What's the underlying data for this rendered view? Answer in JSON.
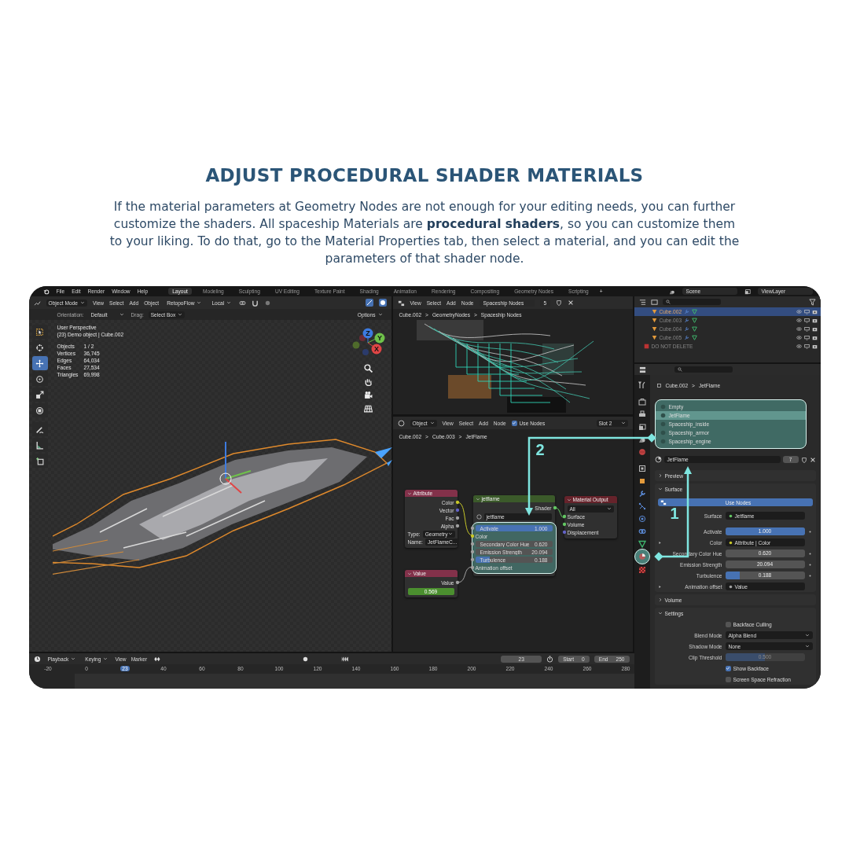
{
  "heading": "ADJUST PROCEDURAL SHADER MATERIALS",
  "description": "If the material parameters at Geometry Nodes are not enough for your editing needs, you can further customize the shaders. All spaceship Materials are **procedural shaders**, so you can customize them to your liking. To do that, go to the Material Properties tab, then select a material, and you can edit the parameters of that shader node.",
  "top_bar": {
    "menus": [
      "File",
      "Edit",
      "Render",
      "Window",
      "Help"
    ],
    "workspaces": [
      {
        "label": "Layout",
        "selected": true
      },
      {
        "label": "Modeling",
        "selected": false
      },
      {
        "label": "Sculpting",
        "selected": false
      },
      {
        "label": "UV Editing",
        "selected": false
      },
      {
        "label": "Texture Paint",
        "selected": false
      },
      {
        "label": "Shading",
        "selected": false
      },
      {
        "label": "Animation",
        "selected": false
      },
      {
        "label": "Rendering",
        "selected": false
      },
      {
        "label": "Compositing",
        "selected": false
      },
      {
        "label": "Geometry Nodes",
        "selected": false
      },
      {
        "label": "Scripting",
        "selected": false
      }
    ],
    "add_workspace": "+",
    "scene": "Scene",
    "view_layer": "ViewLayer"
  },
  "viewport": {
    "mode": "Object Mode",
    "menus": [
      "View",
      "Select",
      "Add",
      "Object"
    ],
    "addon": "RetopoFlow",
    "pivot": "Local",
    "orientation_label": "Orientation:",
    "orientation": "Default",
    "drag_label": "Drag:",
    "drag": "Select Box",
    "options": "Options",
    "tools": [
      {
        "kind": "select",
        "selected": false
      },
      {
        "kind": "cursor",
        "selected": false
      },
      {
        "kind": "move",
        "selected": true
      },
      {
        "kind": "rotate",
        "selected": false
      },
      {
        "kind": "scale",
        "selected": false
      },
      {
        "kind": "transform",
        "selected": false
      },
      {
        "kind": "annotate",
        "selected": false
      },
      {
        "kind": "measure",
        "selected": false
      },
      {
        "kind": "add_cube",
        "selected": false
      }
    ],
    "view_name": "User Perspective",
    "object_line": "(23) Demo object | Cube.002",
    "stats": [
      {
        "label": "Objects",
        "value": "1 / 2"
      },
      {
        "label": "Vertices",
        "value": "36,745"
      },
      {
        "label": "Edges",
        "value": "64,034"
      },
      {
        "label": "Faces",
        "value": "27,534"
      },
      {
        "label": "Triangles",
        "value": "69,998"
      }
    ],
    "gizmo_axes": [
      "Z",
      "Y",
      "X"
    ]
  },
  "geometry_editor": {
    "menus": [
      "View",
      "Select",
      "Add",
      "Node"
    ],
    "node_group": "Spaceship Nodes",
    "users": "5",
    "breadcrumb": [
      "Cube.002",
      ">",
      "GeometryNodes",
      ">",
      "Spaceship Nodes"
    ]
  },
  "shader_editor": {
    "object": "Object",
    "menus": [
      "View",
      "Select",
      "Add",
      "Node"
    ],
    "use_nodes": {
      "label": "Use Nodes",
      "checked": true
    },
    "slot": "Slot 2",
    "breadcrumb": [
      "Cube.002",
      ">",
      "Cube.003",
      ">",
      "JetFlame"
    ],
    "attribute_node": {
      "title": "Attribute",
      "outputs": [
        {
          "label": "Color",
          "color": "#c7c729"
        },
        {
          "label": "Vector",
          "color": "#6363c7"
        },
        {
          "label": "Fac",
          "color": "#a1a1a1"
        },
        {
          "label": "Alpha",
          "color": "#a1a1a1"
        }
      ],
      "type_label": "Type:",
      "type": "Geometry",
      "name_label": "Name:",
      "name": "JetFlameC..."
    },
    "value_node": {
      "title": "Value",
      "output": "Value",
      "value": "0.569"
    },
    "group_node": {
      "title": "jetflame",
      "output": "Shader",
      "datablock": "jetflame",
      "inputs": [
        {
          "kind": "slider",
          "label": "Activate",
          "value": "1.000",
          "level": 1
        },
        {
          "kind": "socket",
          "label": "Color",
          "color": "#c7c729"
        },
        {
          "kind": "number",
          "label": "Secondary Color Hue",
          "value": "0.620"
        },
        {
          "kind": "number",
          "label": "Emission Strength",
          "value": "20.094"
        },
        {
          "kind": "slider",
          "label": "Turbulence",
          "value": "0.188",
          "level": 0.188
        },
        {
          "kind": "socket",
          "label": "Animation offset",
          "color": "#a1a1a1"
        }
      ]
    },
    "output_node": {
      "title": "Material Output",
      "target": "All",
      "inputs": [
        {
          "label": "Surface",
          "color": "#63c763"
        },
        {
          "label": "Volume",
          "color": "#63c763"
        },
        {
          "label": "Displacement",
          "color": "#6363c7"
        }
      ]
    }
  },
  "outliner": {
    "rows": [
      {
        "name": "Cube.002",
        "kind": "object",
        "selected": true
      },
      {
        "name": "Cube.003",
        "kind": "object",
        "selected": false
      },
      {
        "name": "Cube.004",
        "kind": "object",
        "selected": false
      },
      {
        "name": "Cube.005",
        "kind": "object",
        "selected": false
      },
      {
        "name": "DO NOT DELETE",
        "kind": "collection",
        "selected": false
      }
    ]
  },
  "properties": {
    "tabs": [
      {
        "kind": "tool",
        "selected": false
      },
      {
        "kind": "render",
        "selected": false
      },
      {
        "kind": "output",
        "selected": false
      },
      {
        "kind": "view_layer",
        "selected": false
      },
      {
        "kind": "scene",
        "selected": false
      },
      {
        "kind": "world",
        "selected": false
      },
      {
        "kind": "collection",
        "selected": false
      },
      {
        "kind": "object",
        "selected": false
      },
      {
        "kind": "modifier",
        "selected": false
      },
      {
        "kind": "particles",
        "selected": false
      },
      {
        "kind": "physics",
        "selected": false
      },
      {
        "kind": "constraints",
        "selected": false
      },
      {
        "kind": "data",
        "selected": false
      },
      {
        "kind": "material",
        "selected": true
      },
      {
        "kind": "texture",
        "selected": false
      }
    ],
    "breadcrumb": [
      "Cube.002",
      ">",
      "JetFlame"
    ],
    "slots": [
      {
        "name": "Empty",
        "selected": false
      },
      {
        "name": "JetFlame",
        "selected": true
      },
      {
        "name": "Spaceship_inside",
        "selected": false
      },
      {
        "name": "Spaceship_armor",
        "selected": false
      },
      {
        "name": "Spaceship_engine",
        "selected": false
      }
    ],
    "material": "JetFlame",
    "users": "7",
    "panels": [
      {
        "title": "Preview",
        "expanded": false
      },
      {
        "title": "Surface",
        "expanded": true,
        "rows": [
          {
            "kind": "button",
            "label": "Use Nodes"
          },
          {
            "kind": "link",
            "label": "Surface",
            "value": "Jetflame",
            "color": "#63c763",
            "expandable": false
          },
          {
            "kind": "slider",
            "label": "Activate",
            "value": "1.000",
            "level": 1,
            "disabled": false
          },
          {
            "kind": "link",
            "label": "Color",
            "value": "Attribute | Color",
            "color": "#c7c729",
            "expandable": true
          },
          {
            "kind": "number",
            "label": "Secondary Color Hue",
            "value": "0.620"
          },
          {
            "kind": "number",
            "label": "Emission Strength",
            "value": "20.094"
          },
          {
            "kind": "slider",
            "label": "Turbulence",
            "value": "0.188",
            "level": 0.188,
            "disabled": false
          },
          {
            "kind": "link",
            "label": "Animation offset",
            "value": "Value",
            "color": "#a1a1a1",
            "expandable": true
          }
        ]
      },
      {
        "title": "Volume",
        "expanded": false
      },
      {
        "title": "Settings",
        "expanded": true,
        "rows": [
          {
            "kind": "checkbox",
            "label": "Backface Culling",
            "checked": false
          },
          {
            "kind": "dropdown",
            "label": "Blend Mode",
            "value": "Alpha Blend"
          },
          {
            "kind": "dropdown",
            "label": "Shadow Mode",
            "value": "None"
          },
          {
            "kind": "slider",
            "label": "Clip Threshold",
            "value": "0.500",
            "level": 0.5,
            "disabled": true
          },
          {
            "kind": "checkbox",
            "label": "Show Backface",
            "checked": true
          },
          {
            "kind": "checkbox",
            "label": "Screen Space Refraction",
            "checked": false
          }
        ]
      }
    ]
  },
  "timeline": {
    "dropdowns": [
      "Playback",
      "Keying"
    ],
    "menus": [
      "View",
      "Marker"
    ],
    "frame": "23",
    "start_label": "Start",
    "start": "0",
    "end_label": "End",
    "end": "250",
    "ruler": [
      {
        "label": "-20",
        "current": false
      },
      {
        "label": "0",
        "current": false
      },
      {
        "label": "23",
        "current": true
      },
      {
        "label": "40",
        "current": false
      },
      {
        "label": "60",
        "current": false
      },
      {
        "label": "80",
        "current": false
      },
      {
        "label": "100",
        "current": false
      },
      {
        "label": "120",
        "current": false
      },
      {
        "label": "140",
        "current": false
      },
      {
        "label": "160",
        "current": false
      },
      {
        "label": "180",
        "current": false
      },
      {
        "label": "200",
        "current": false
      },
      {
        "label": "220",
        "current": false
      },
      {
        "label": "240",
        "current": false
      },
      {
        "label": "260",
        "current": false
      },
      {
        "label": "280",
        "current": false
      }
    ]
  },
  "annotations": [
    {
      "label": "2"
    },
    {
      "label": "1"
    }
  ]
}
